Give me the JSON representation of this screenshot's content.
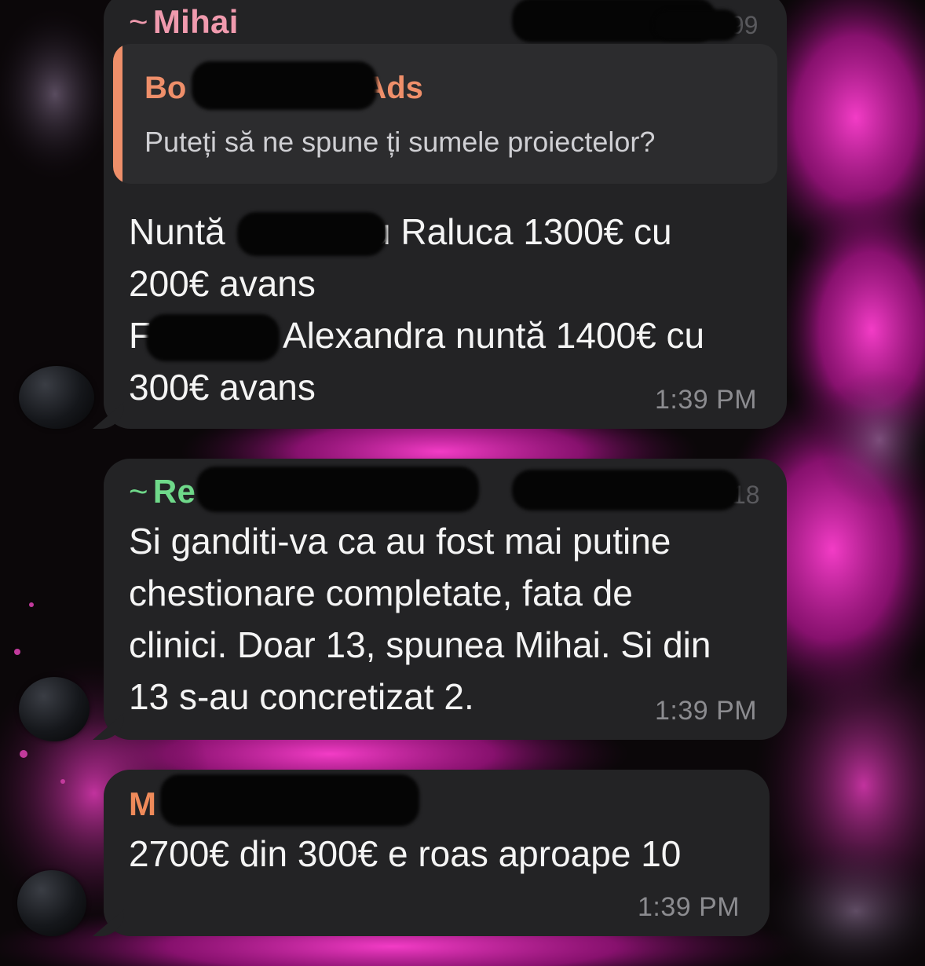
{
  "colors": {
    "bubble": "#232325",
    "sender_mihai": "#f09aae",
    "sender_re": "#6fd98a",
    "sender_m": "#ef8a5a",
    "quote_accent": "#ef8f6a",
    "timestamp": "#8c8c90"
  },
  "messages": [
    {
      "sender_prefix": "~",
      "sender": "Mihai",
      "phone_tail": "199",
      "quote": {
        "title_left": "Bo",
        "title_right": "Ads",
        "text": "Puteți să ne spune ți sumele proiectelor?"
      },
      "lines": [
        "Nuntă",
        "u Raluca 1300€ cu",
        "200€ avans",
        "F",
        "Alexandra nuntă 1400€ cu",
        "300€ avans"
      ],
      "time": "1:39 PM"
    },
    {
      "sender_prefix": "~",
      "sender": "Re",
      "phone_tail": "18",
      "lines": [
        "Si ganditi-va ca au fost mai putine",
        "chestionare completate, fata de",
        "clinici. Doar 13, spunea Mihai. Si din",
        "13 s-au concretizat 2."
      ],
      "time": "1:39 PM"
    },
    {
      "sender": "M",
      "lines": [
        "2700€ din 300€ e roas aproape 10"
      ],
      "time": "1:39 PM"
    }
  ]
}
